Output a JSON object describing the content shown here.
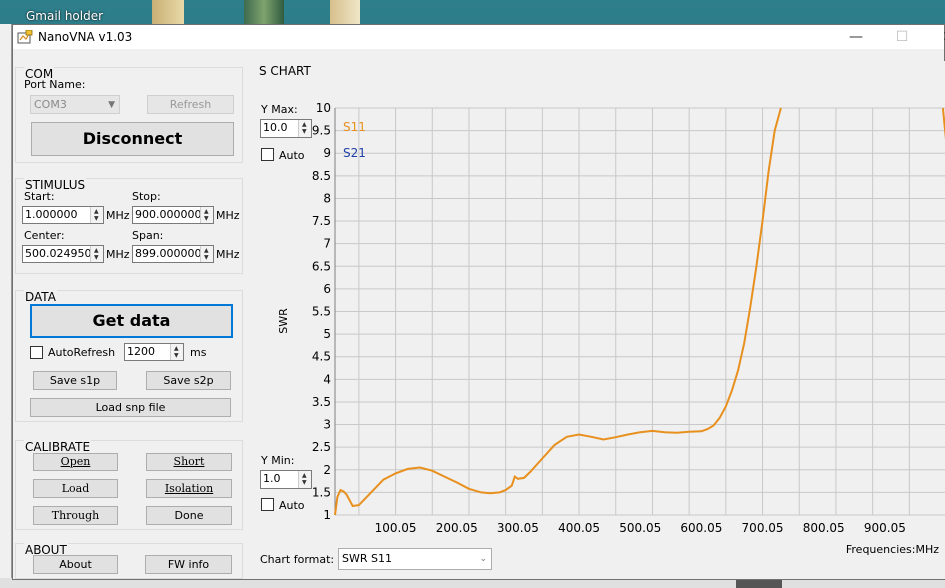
{
  "desktop": {
    "gmail_label": "Gmail holder"
  },
  "window": {
    "title": "NanoVNA v1.03",
    "controls": {
      "min": "—",
      "max": "☐",
      "close": "✕"
    }
  },
  "com": {
    "title": "COM",
    "port_label": "Port Name:",
    "port_value": "COM3",
    "refresh_label": "Refresh",
    "disconnect_label": "Disconnect"
  },
  "stimulus": {
    "title": "STIMULUS",
    "start_label": "Start:",
    "start_value": "1.000000",
    "stop_label": "Stop:",
    "stop_value": "900.000000",
    "center_label": "Center:",
    "center_value": "500.024950",
    "span_label": "Span:",
    "span_value": "899.000000",
    "unit": "MHz"
  },
  "data": {
    "title": "DATA",
    "get_data_label": "Get data",
    "autorefresh_label": "AutoRefresh",
    "interval_value": "1200",
    "interval_unit": "ms",
    "save_s1p_label": "Save s1p",
    "save_s2p_label": "Save s2p",
    "load_snp_label": "Load snp file"
  },
  "calibrate": {
    "title": "CALIBRATE",
    "open_label": "Open",
    "short_label": "Short",
    "load_label": "Load",
    "isolation_label": "Isolation",
    "through_label": "Through",
    "done_label": "Done"
  },
  "about": {
    "title": "ABOUT",
    "about_label": "About",
    "fw_info_label": "FW info"
  },
  "chart_panel": {
    "title": "S CHART",
    "ymax_label": "Y Max:",
    "ymax_value": "10.0",
    "ymax_auto_label": "Auto",
    "ymin_label": "Y Min:",
    "ymin_value": "1.0",
    "ymin_auto_label": "Auto",
    "chart_format_label": "Chart format:",
    "chart_format_value": "SWR S11"
  },
  "colors": {
    "s11": "#e8901e",
    "s21": "#1f3fa8",
    "grid": "#c8c8c8",
    "focus": "#0078d7"
  },
  "chart_data": {
    "type": "line",
    "xlabel": "Frequencies:MHz",
    "ylabel": "SWR",
    "xlim": [
      1,
      1000
    ],
    "ylim": [
      1,
      10
    ],
    "x_ticks": [
      "100.05",
      "200.05",
      "300.05",
      "400.05",
      "500.05",
      "600.05",
      "700.05",
      "800.05",
      "900.05"
    ],
    "y_ticks": [
      "1",
      "1.5",
      "2",
      "2.5",
      "3",
      "3.5",
      "4",
      "4.5",
      "5",
      "5.5",
      "6",
      "6.5",
      "7",
      "7.5",
      "8",
      "8.5",
      "9",
      "9.5",
      "10"
    ],
    "grid": true,
    "legend": [
      "S11",
      "S21"
    ],
    "legend_position": "top-left",
    "series": [
      {
        "name": "S11",
        "x": [
          1,
          5,
          10,
          15,
          20,
          30,
          40,
          60,
          80,
          100,
          120,
          140,
          160,
          180,
          200,
          220,
          240,
          255,
          270,
          280,
          290,
          295,
          300,
          310,
          320,
          340,
          360,
          380,
          400,
          420,
          440,
          460,
          480,
          500,
          520,
          540,
          560,
          580,
          600,
          610,
          620,
          630,
          640,
          650,
          660,
          670,
          680,
          690,
          700,
          710,
          720,
          730,
          738,
          995,
          1000
        ],
        "y": [
          1.0,
          1.4,
          1.55,
          1.52,
          1.45,
          1.2,
          1.22,
          1.5,
          1.78,
          1.92,
          2.02,
          2.05,
          1.98,
          1.85,
          1.72,
          1.58,
          1.5,
          1.48,
          1.5,
          1.55,
          1.65,
          1.85,
          1.8,
          1.82,
          1.95,
          2.25,
          2.55,
          2.73,
          2.78,
          2.73,
          2.67,
          2.72,
          2.78,
          2.83,
          2.86,
          2.83,
          2.82,
          2.84,
          2.85,
          2.9,
          2.98,
          3.15,
          3.4,
          3.75,
          4.2,
          4.8,
          5.6,
          6.5,
          7.5,
          8.6,
          9.5,
          10.0,
          10.0,
          10.0,
          9.3
        ]
      }
    ]
  }
}
